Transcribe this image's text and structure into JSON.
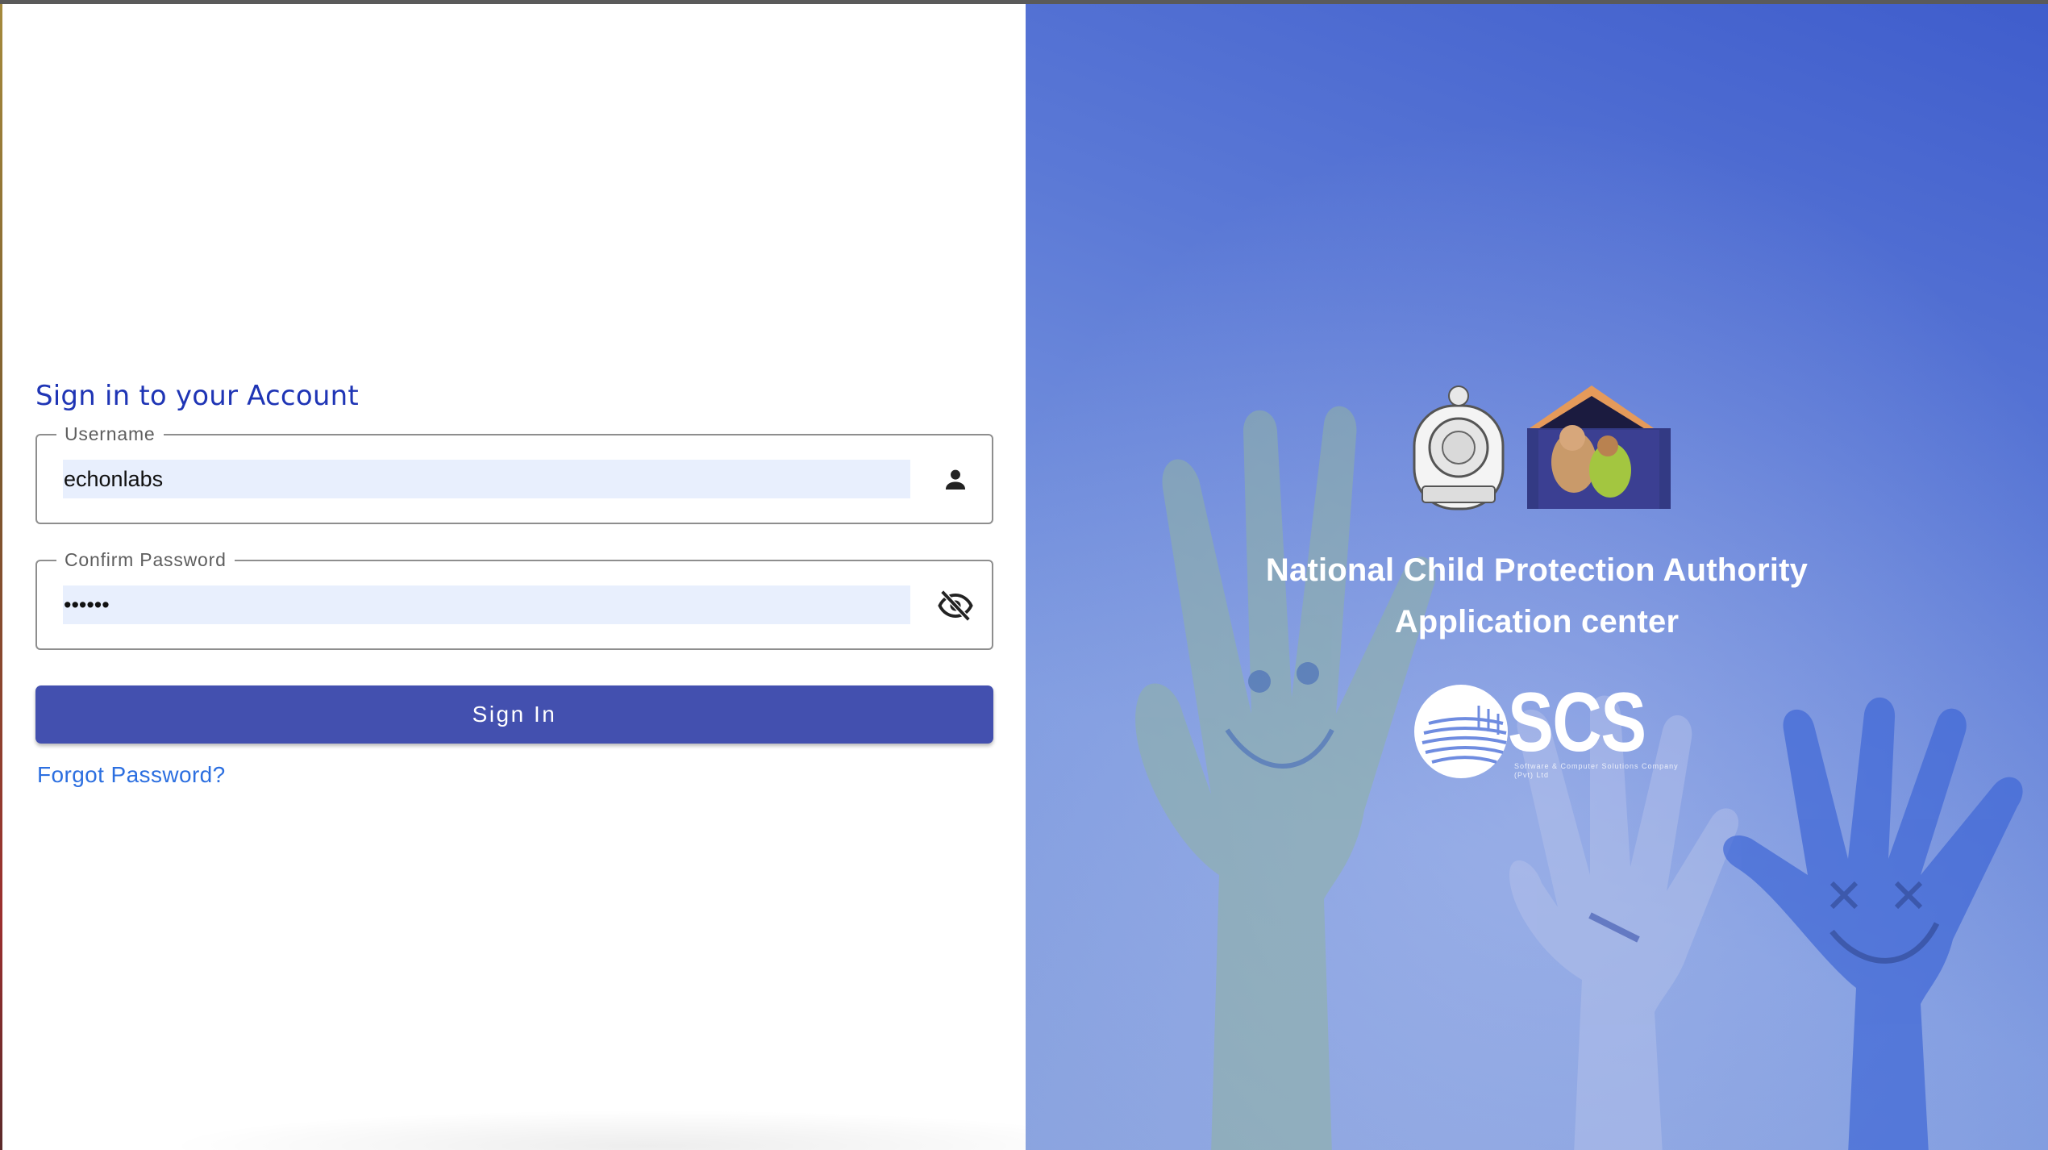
{
  "login": {
    "title": "Sign in to your Account",
    "username": {
      "label": "Username",
      "value": "echonlabs"
    },
    "password": {
      "label": "Confirm Password",
      "value": "••••••"
    },
    "sign_in_label": "Sign In",
    "forgot_password_label": "Forgot Password?"
  },
  "branding": {
    "line1": "National Child Protection Authority",
    "line2": "Application center",
    "scs_logo_text": "SCS",
    "scs_subtitle": "Software & Computer Solutions Company (Pvt) Ltd"
  },
  "icons": {
    "username_icon": "person-icon",
    "password_icon": "eye-off-icon"
  },
  "colors": {
    "primary": "#4350af",
    "title": "#1f35b5",
    "link": "#2c6fe0",
    "input_fill": "#e8effd",
    "panel_gradient_top": "#3f5dcc",
    "panel_gradient_bottom": "#8aa3df"
  }
}
